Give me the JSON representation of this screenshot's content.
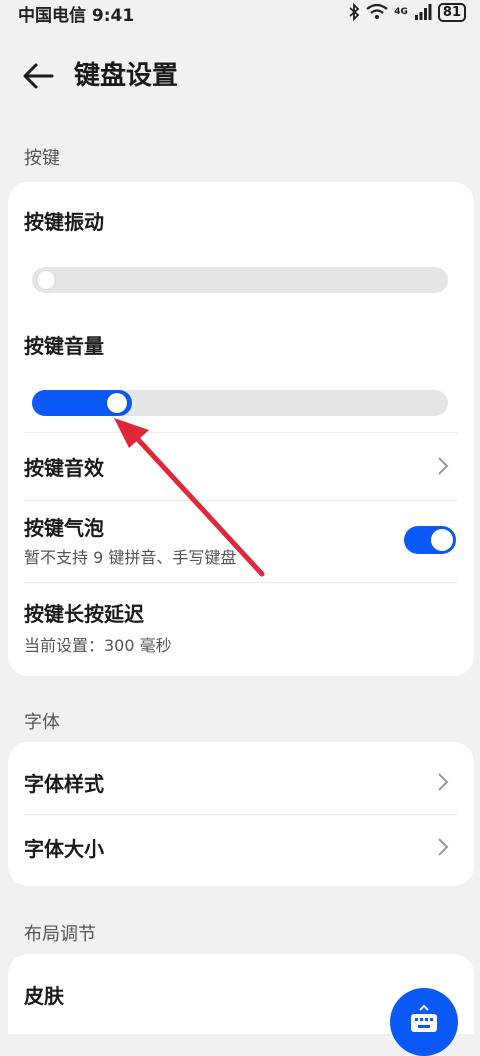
{
  "status_bar": {
    "carrier_time": "中国电信 9:41",
    "network": "4G",
    "battery": "81"
  },
  "header": {
    "title": "键盘设置"
  },
  "sections": {
    "keys": {
      "title": "按键",
      "vibration": {
        "label": "按键振动",
        "level": 0.0
      },
      "volume": {
        "label": "按键音量",
        "level": 0.2
      },
      "sound_effect": {
        "label": "按键音效"
      },
      "bubble": {
        "label": "按键气泡",
        "subtitle": "暂不支持 9 键拼音、手写键盘",
        "enabled": true
      },
      "long_press": {
        "label": "按键长按延迟",
        "subtitle": "当前设置：300 毫秒"
      }
    },
    "font": {
      "title": "字体",
      "style": {
        "label": "字体样式"
      },
      "size": {
        "label": "字体大小"
      }
    },
    "layout": {
      "title": "布局调节",
      "skin": {
        "label": "皮肤"
      }
    }
  },
  "colors": {
    "accent": "#0a59f7",
    "annotation_arrow": "#e0283a"
  }
}
